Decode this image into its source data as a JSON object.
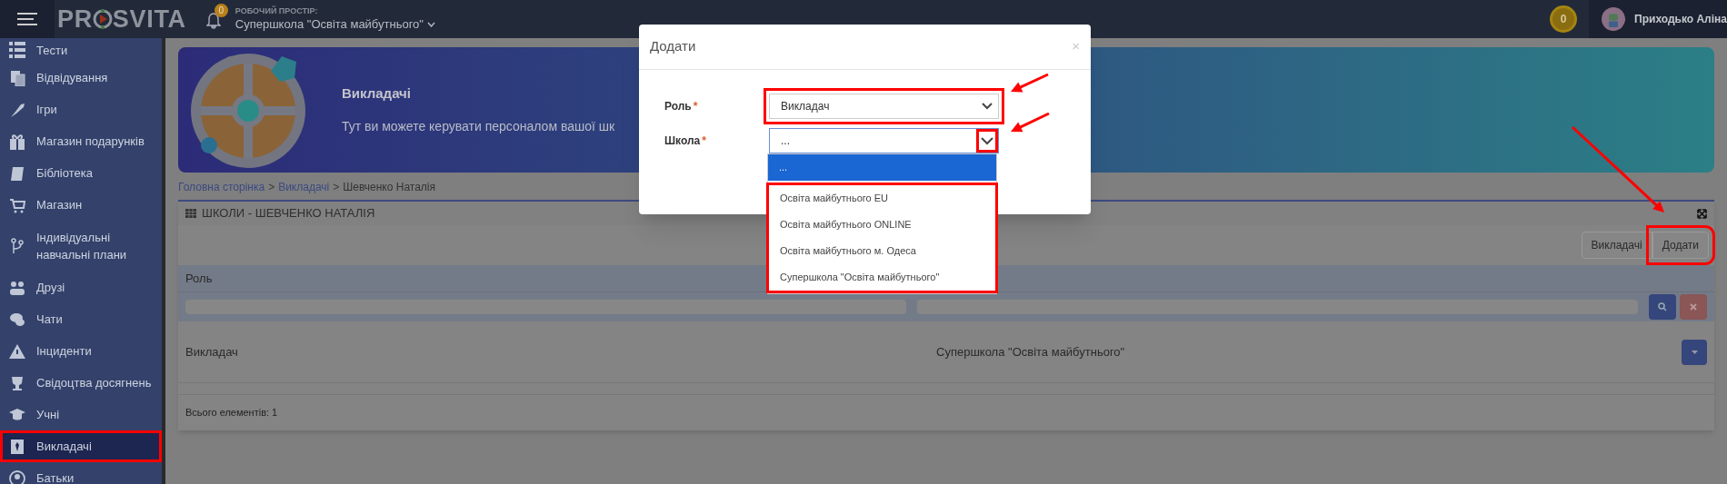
{
  "header": {
    "logo": {
      "before": "PR",
      "after": "SVITA"
    },
    "notifications": "0",
    "workspace_label": "РОБОЧИЙ ПРОСТІР:",
    "workspace": "Супершкола \"Освіта майбутнього\"",
    "coins": "0",
    "user": "Приходько Аліна"
  },
  "sidebar": {
    "items": [
      {
        "label": "Тести",
        "selected": false
      },
      {
        "label": "Відвідування",
        "selected": false
      },
      {
        "label": "Ігри",
        "selected": false
      },
      {
        "label": "Магазин подарунків",
        "selected": false
      },
      {
        "label": "Бібліотека",
        "selected": false
      },
      {
        "label": "Магазин",
        "selected": false
      },
      {
        "label": "Індивідуальні навчальні плани",
        "selected": false
      },
      {
        "label": "Друзі",
        "selected": false
      },
      {
        "label": "Чати",
        "selected": false
      },
      {
        "label": "Інциденти",
        "selected": false
      },
      {
        "label": "Свідоцтва досягнень",
        "selected": false
      },
      {
        "label": "Учні",
        "selected": false
      },
      {
        "label": "Викладачі",
        "selected": true
      },
      {
        "label": "Батьки",
        "selected": false
      }
    ]
  },
  "banner": {
    "title": "Викладачі",
    "text": "Тут ви можете керувати персоналом вашої шк"
  },
  "breadcrumb": [
    {
      "label": "Головна сторінка",
      "kind": "link"
    },
    {
      "separator": ">",
      "label": "Викладачі",
      "kind": "link"
    },
    {
      "separator": ">",
      "label": "Шевченко Наталія",
      "kind": "current"
    }
  ],
  "panel": {
    "title": "ШКОЛИ - ШЕВЧЕНКО НАТАЛІЯ",
    "buttons": [
      "Викладачі",
      "Додати"
    ],
    "table": {
      "columns": [
        "Роль"
      ],
      "rows": [
        [
          "Викладач",
          "Супершкола \"Освіта майбутнього\""
        ]
      ]
    },
    "footer": "Всього елементів: 1"
  },
  "modal": {
    "title": "Додати",
    "close": "×",
    "fields": [
      {
        "label": "Роль",
        "required": true,
        "required_mark": "*",
        "value": "Викладач",
        "open": false
      },
      {
        "label": "Школа",
        "required": true,
        "required_mark": "*",
        "value": "...",
        "open": true,
        "options": [
          {
            "label": "...",
            "selected": true
          },
          {
            "label": "Освіта майбутнього EU",
            "selected": false
          },
          {
            "label": "Освіта майбутнього ONLINE",
            "selected": false
          },
          {
            "label": "Освіта майбутнього м. Одеса",
            "selected": false
          },
          {
            "label": "Супершкола \"Освіта майбутнього\"",
            "selected": false
          }
        ]
      }
    ]
  }
}
